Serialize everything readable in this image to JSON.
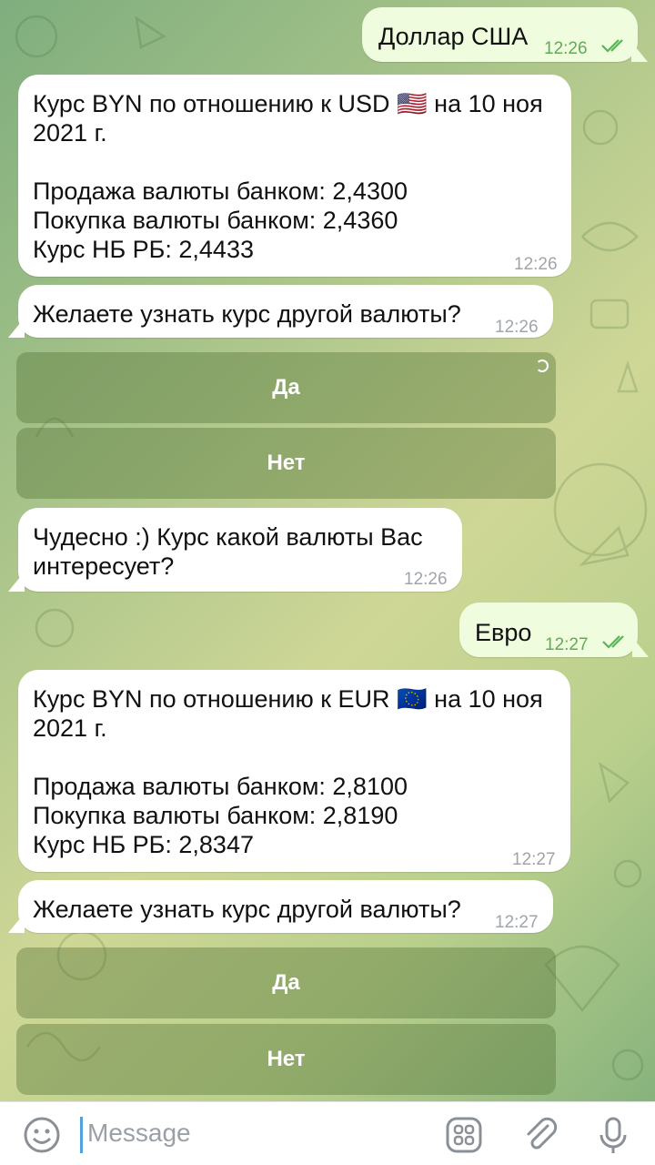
{
  "messages": [
    {
      "type": "outgoing",
      "text": "Доллар США",
      "time": "12:26"
    },
    {
      "type": "incoming",
      "text": "Курс BYN по отношению к USD 🇺🇸 на 10 ноя\n2021 г.\n\nПродажа валюты банком: 2,4300\nПокупка валюты банком: 2,4360\nКурс НБ РБ: 2,4433",
      "time": "12:26"
    },
    {
      "type": "incoming",
      "text": "Желаете узнать курс другой валюты?",
      "time": "12:26"
    },
    {
      "type": "incoming",
      "text": "Чудесно :) Курс какой валюты Вас\nинтересует?",
      "time": "12:26"
    },
    {
      "type": "outgoing",
      "text": "Евро",
      "time": "12:27"
    },
    {
      "type": "incoming",
      "text": "Курс BYN по отношению к EUR 🇪🇺 на 10 ноя\n2021 г.\n\nПродажа валюты банком: 2,8100\nПокупка валюты банком: 2,8190\nКурс НБ РБ: 2,8347",
      "time": "12:27"
    },
    {
      "type": "incoming",
      "text": "Желаете узнать курс другой валюты?",
      "time": "12:27"
    }
  ],
  "keyboard1": {
    "yes": "Да",
    "no": "Нет"
  },
  "keyboard2": {
    "yes": "Да",
    "no": "Нет"
  },
  "input": {
    "placeholder": "Message"
  },
  "icons": {
    "emoji": "smiley-icon",
    "commands": "bot-commands-icon",
    "attach": "paperclip-icon",
    "mic": "microphone-icon"
  },
  "colors": {
    "outgoing_bubble": "#effdde",
    "incoming_bubble": "#ffffff",
    "button_overlay": "#506e32",
    "accent": "#4fa3e4"
  }
}
